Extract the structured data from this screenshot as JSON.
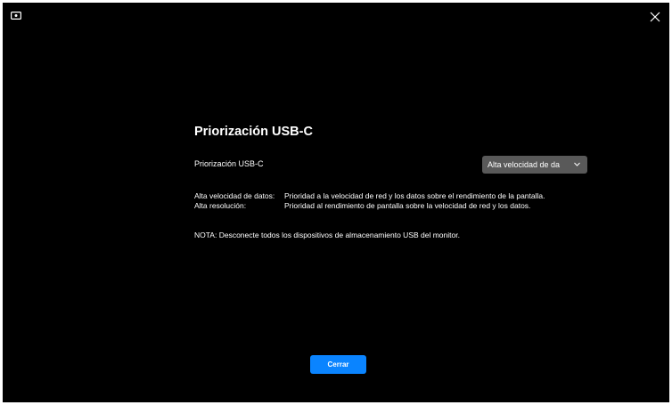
{
  "header": {
    "monitor_icon": "monitor-icon",
    "close_icon": "close-icon"
  },
  "main": {
    "title": "Priorización USB-C",
    "setting_label": "Priorización USB-C",
    "dropdown_value": "Alta velocidad de da",
    "dropdown_icon": "chevron-down-icon",
    "descriptions": [
      {
        "term": "Alta velocidad de datos:",
        "definition": "Prioridad a la velocidad de red y los datos sobre el rendimiento de la pantalla."
      },
      {
        "term": "Alta resolución:",
        "definition": "Prioridad al rendimiento de pantalla sobre la velocidad de red y los datos."
      }
    ],
    "note": "NOTA: Desconecte todos los dispositivos de almacenamiento USB del monitor."
  },
  "footer": {
    "close_button": "Cerrar"
  },
  "colors": {
    "background": "#000000",
    "dropdown_bg": "#595959",
    "accent": "#0a84ff",
    "text": "#ffffff"
  }
}
